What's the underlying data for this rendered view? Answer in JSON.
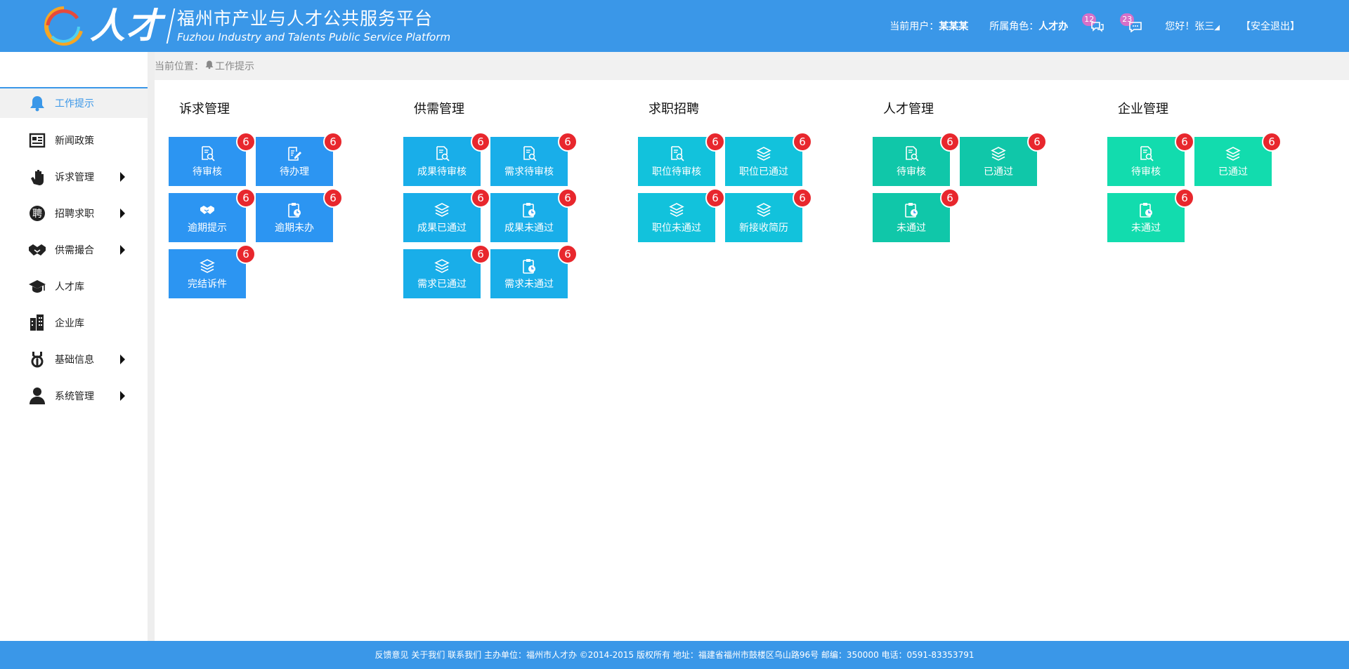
{
  "header": {
    "logo_word": "人才",
    "title_cn": "福州市产业与人才公共服务平台",
    "title_en": "Fuzhou Industry and Talents Public Service Platform",
    "current_user_label": "当前用户：",
    "current_user": "某某某",
    "role_label": "所属角色：",
    "role": "人才办",
    "notify_count": "12",
    "message_count": "23",
    "greeting": "您好！张三",
    "logout": "【安全退出】"
  },
  "breadcrumb": {
    "label": "当前位置：",
    "page": "工作提示"
  },
  "sidebar": {
    "items": [
      {
        "label": "工作提示",
        "icon": "bell-icon",
        "active": true,
        "submenu": false
      },
      {
        "label": "新闻政策",
        "icon": "newspaper-icon",
        "submenu": false
      },
      {
        "label": "诉求管理",
        "icon": "hand-icon",
        "submenu": true
      },
      {
        "label": "招聘求职",
        "icon": "recruit-icon",
        "submenu": true
      },
      {
        "label": "供需撮合",
        "icon": "handshake-icon",
        "submenu": true
      },
      {
        "label": "人才库",
        "icon": "graduation-cap-icon",
        "submenu": false
      },
      {
        "label": "企业库",
        "icon": "building-icon",
        "submenu": false
      },
      {
        "label": "基础信息",
        "icon": "wrench-icon",
        "submenu": true
      },
      {
        "label": "系统管理",
        "icon": "user-icon",
        "submenu": true
      }
    ]
  },
  "groups": [
    {
      "title": "诉求管理",
      "tiles": [
        {
          "label": "待审核",
          "icon": "document-search-icon",
          "count": "6"
        },
        {
          "label": "待办理",
          "icon": "edit-document-icon",
          "count": "6"
        },
        {
          "label": "逾期提示",
          "icon": "handshake-icon",
          "count": "6"
        },
        {
          "label": "逾期未办",
          "icon": "clipboard-clock-icon",
          "count": "6"
        },
        {
          "label": "完结诉件",
          "icon": "layers-icon",
          "count": "6"
        }
      ]
    },
    {
      "title": "供需管理",
      "tiles": [
        {
          "label": "成果待审核",
          "icon": "document-search-icon",
          "count": "6"
        },
        {
          "label": "需求待审核",
          "icon": "document-search-icon",
          "count": "6"
        },
        {
          "label": "成果已通过",
          "icon": "layers-icon",
          "count": "6"
        },
        {
          "label": "成果未通过",
          "icon": "clipboard-clock-icon",
          "count": "6"
        },
        {
          "label": "需求已通过",
          "icon": "layers-icon",
          "count": "6"
        },
        {
          "label": "需求未通过",
          "icon": "clipboard-clock-icon",
          "count": "6"
        }
      ]
    },
    {
      "title": "求职招聘",
      "tiles": [
        {
          "label": "职位待审核",
          "icon": "document-search-icon",
          "count": "6"
        },
        {
          "label": "职位已通过",
          "icon": "layers-icon",
          "count": "6"
        },
        {
          "label": "职位未通过",
          "icon": "layers-icon",
          "count": "6"
        },
        {
          "label": "新接收简历",
          "icon": "layers-icon",
          "count": "6"
        }
      ]
    },
    {
      "title": "人才管理",
      "tiles": [
        {
          "label": "待审核",
          "icon": "document-search-icon",
          "count": "6"
        },
        {
          "label": "已通过",
          "icon": "layers-icon",
          "count": "6"
        },
        {
          "label": "未通过",
          "icon": "clipboard-clock-icon",
          "count": "6"
        }
      ]
    },
    {
      "title": "企业管理",
      "tiles": [
        {
          "label": "待审核",
          "icon": "document-search-icon",
          "count": "6"
        },
        {
          "label": "已通过",
          "icon": "layers-icon",
          "count": "6"
        },
        {
          "label": "未通过",
          "icon": "clipboard-clock-icon",
          "count": "6"
        }
      ]
    }
  ],
  "colors": {
    "header": "#3a97e8",
    "group_1": "#2c95f2",
    "group_2": "#19aee9",
    "group_3": "#12c2dc",
    "group_4": "#10c7a9",
    "group_5": "#12dcae",
    "badge": "#e8272d"
  },
  "footer": {
    "text": "反馈意见 关于我们 联系我们 主办单位：福州市人才办   ©2014-2015 版权所有  地址：福建省福州市鼓楼区乌山路96号   邮编：350000 电话：0591-83353791"
  }
}
